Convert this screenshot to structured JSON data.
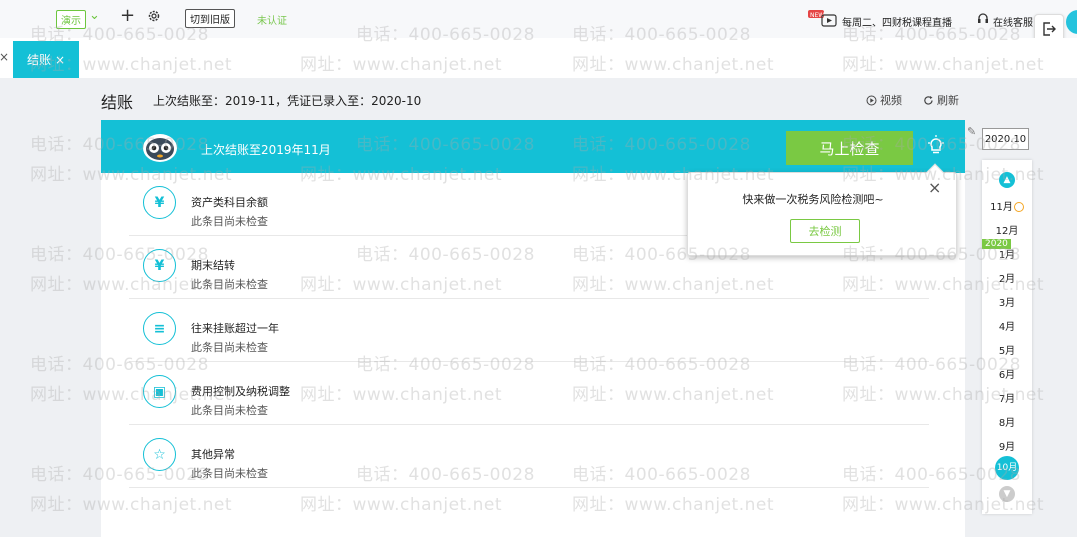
{
  "topbar": {
    "demo_label": "演示",
    "switch_label": "切到旧版",
    "unverified_label": "未认证",
    "new_badge": "NEW",
    "live_text": "每周二、四财税课程直播",
    "customer_service": "在线客服"
  },
  "tabs": [
    {
      "label": "结账",
      "close": "×"
    }
  ],
  "tab_left_close": "×",
  "page": {
    "title": "结账",
    "info": "上次结账至：2019-11，凭证已录入至：2020-10",
    "video_label": "视频",
    "refresh_label": "刷新"
  },
  "banner": {
    "text": "上次结账至2019年11月",
    "check_button": "马上检查"
  },
  "items": [
    {
      "icon": "¥",
      "title": "资产类科目余额",
      "status": "此条目尚未检查"
    },
    {
      "icon": "¥",
      "title": "期末结转",
      "status": "此条目尚未检查"
    },
    {
      "icon": "≡",
      "title": "往来挂账超过一年",
      "status": "此条目尚未检查"
    },
    {
      "icon": "▣",
      "title": "费用控制及纳税调整",
      "status": "此条目尚未检查"
    },
    {
      "icon": "☆",
      "title": "其他异常",
      "status": "此条目尚未检查"
    }
  ],
  "popup": {
    "text": "快来做一次税务风险检测吧~",
    "button": "去检测",
    "close": "×"
  },
  "date_panel": {
    "current": "2020.10",
    "year_tag": "2020",
    "months": [
      "11月",
      "12月",
      "1月",
      "2月",
      "3月",
      "4月",
      "5月",
      "6月",
      "7月",
      "8月",
      "9月",
      "10月"
    ]
  },
  "watermark": {
    "phone": "电话：400-665-0028",
    "site": "网址：www.chanjet.net"
  },
  "colors": {
    "accent": "#14c0d6",
    "green": "#7ac943",
    "warning": "#f5a623"
  }
}
